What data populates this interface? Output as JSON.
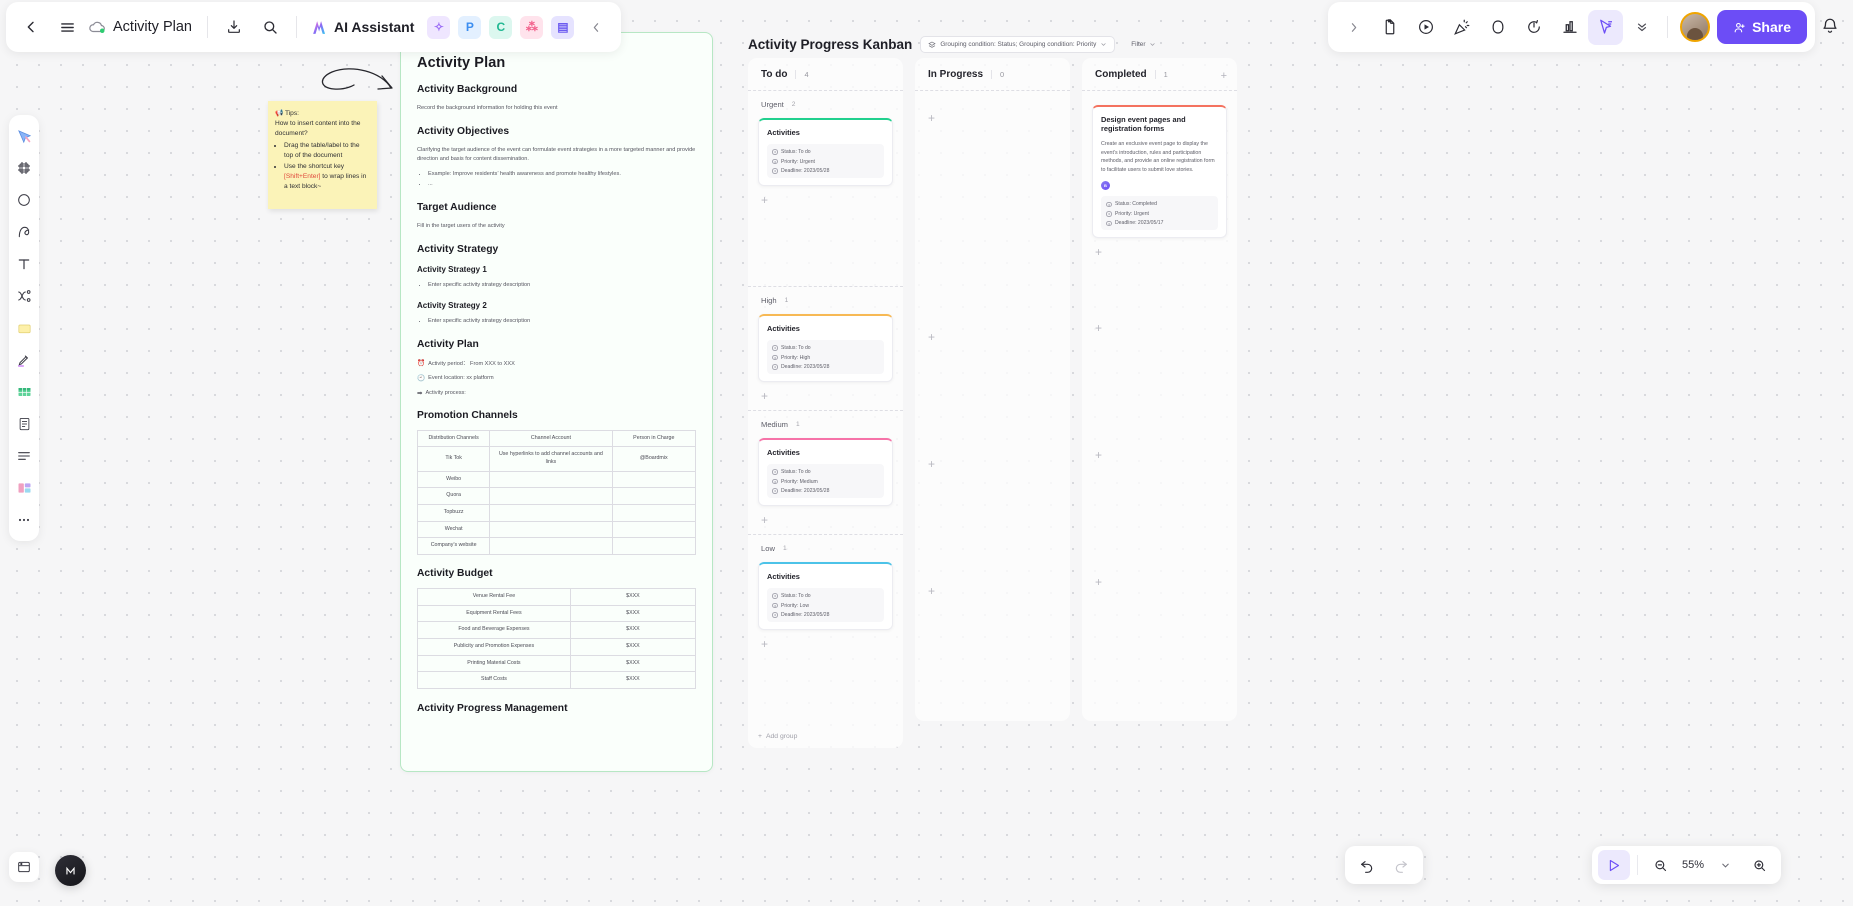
{
  "topbar": {
    "back_icon": "chevron-left-icon",
    "menu_icon": "hamburger-menu-icon",
    "doc_title": "Activity Plan",
    "download_icon": "download-icon",
    "search_icon": "search-icon",
    "ai_assistant_label": "AI Assistant",
    "apps": [
      {
        "name": "image-app",
        "glyph": "✧",
        "bg": "#efe6ff",
        "fg": "#9b6cf6"
      },
      {
        "name": "presentation-app",
        "glyph": "P",
        "bg": "#e3f0ff",
        "fg": "#3c8ef0"
      },
      {
        "name": "mindmap-app",
        "glyph": "C",
        "bg": "#dcf7ef",
        "fg": "#21b892"
      },
      {
        "name": "network-app",
        "glyph": "☸",
        "bg": "#ffe3ec",
        "fg": "#f25f8a"
      },
      {
        "name": "chat-app",
        "glyph": "▤",
        "bg": "#e6e3ff",
        "fg": "#6c5bf0"
      }
    ],
    "collapse_icon": "chevron-left-icon",
    "right_expand_icon": "chevron-right-icon",
    "right_tools": [
      {
        "name": "note-tool",
        "glyph": "note"
      },
      {
        "name": "record-tool",
        "glyph": "record"
      },
      {
        "name": "celebrate-tool",
        "glyph": "celebrate"
      },
      {
        "name": "shape-tool",
        "glyph": "shape"
      },
      {
        "name": "timer-tool",
        "glyph": "timer"
      },
      {
        "name": "chart-tool",
        "glyph": "chart"
      },
      {
        "name": "pointer-tool",
        "glyph": "pointer"
      }
    ],
    "more_icon": "chevron-double-down-icon",
    "share_label": "Share",
    "bell_icon": "bell-icon"
  },
  "rail": {
    "items": [
      {
        "name": "select-tool",
        "icon": "cursor-select-icon"
      },
      {
        "name": "frame-tool",
        "icon": "frame-icon"
      },
      {
        "name": "shape-tool",
        "icon": "circle-icon"
      },
      {
        "name": "pen-tool",
        "icon": "curve-icon"
      },
      {
        "name": "text-tool",
        "icon": "text-T-icon"
      },
      {
        "name": "connector-tool",
        "icon": "connector-icon"
      },
      {
        "name": "sticky-note-tool",
        "icon": "sticky-note-icon"
      },
      {
        "name": "highlighter-tool",
        "icon": "highlighter-icon"
      },
      {
        "name": "table-tool",
        "icon": "table-icon"
      },
      {
        "name": "document-tool",
        "icon": "document-icon"
      },
      {
        "name": "list-tool",
        "icon": "list-icon"
      },
      {
        "name": "template-tool",
        "icon": "template-icon"
      },
      {
        "name": "more-tools",
        "icon": "ellipsis-icon"
      }
    ],
    "bottom_icon": "export-frame-icon",
    "fab_icon": "assistant-avatar-icon"
  },
  "sticky_note": {
    "emoji": "📢",
    "title": "Tips:",
    "question": "How to insert content into the document?",
    "bullets": [
      "Drag the table/label to the top of the document",
      "Use the shortcut key [Shift+Enter] to wrap lines in a text block~"
    ],
    "highlight": "[Shift+Enter]"
  },
  "document": {
    "title": "Activity Plan",
    "sections": [
      {
        "heading": "Activity Background",
        "body": "Record the background information for holding this event"
      }
    ],
    "objectives_heading": "Activity Objectives",
    "objectives_body": "Clarifying the target audience of the event can formulate event strategies in a more targeted manner and provide direction and basis for content dissemination.",
    "objectives_bullets": [
      "Example: Improve residents’  health awareness and promote healthy lifestyles.",
      "..."
    ],
    "target_audience_heading": "Target Audience",
    "target_audience_body": "Fill in the target users of the activity",
    "strategy_heading": "Activity Strategy",
    "strategy_1_heading": "Activity Strategy 1",
    "strategy_1_bullet": "Enter specific activity strategy description",
    "strategy_2_heading": "Activity Strategy 2",
    "strategy_2_bullet": "Enter specific activity strategy description",
    "plan_heading": "Activity Plan",
    "plan_period": "Activity period： From XXX to XXX",
    "plan_location": "Event location: xx platform",
    "plan_process": "Activity process:",
    "promotion_heading": "Promotion Channels",
    "promotion_table": {
      "headers": [
        "Distribution Channels",
        "Channel Account",
        "Person in Charge"
      ],
      "rows": [
        [
          "Tik Tok",
          "Use hyperlinks to add channel accounts and links",
          "@Boardmix"
        ],
        [
          "Weibo",
          "",
          ""
        ],
        [
          "Quora",
          "",
          ""
        ],
        [
          "Topbuzz",
          "",
          ""
        ],
        [
          "Wechat",
          "",
          ""
        ],
        [
          "Company’s website",
          "",
          ""
        ]
      ]
    },
    "budget_heading": "Activity Budget",
    "budget_table": {
      "rows": [
        [
          "Venue Rental Fee",
          "$XXX"
        ],
        [
          "Equipment Rental Fees",
          "$XXX"
        ],
        [
          "Food and Beverage Expenses",
          "$XXX"
        ],
        [
          "Publicity and Promotion Expenses",
          "$XXX"
        ],
        [
          "Printing Material Costs",
          "$XXX"
        ],
        [
          "Staff Costs",
          "$XXX"
        ]
      ]
    },
    "progress_heading": "Activity Progress Management"
  },
  "kanban": {
    "title": "Activity Progress Kanban",
    "grouping_label": "Grouping condition: Status; Grouping condition: Priority",
    "grouping_icon": "layers-icon",
    "grouping_caret": "chevron-down-icon",
    "filter_label": "Filter",
    "filter_caret": "chevron-down-icon",
    "add_group_label": "Add group",
    "columns": [
      {
        "name": "To do",
        "count": "4",
        "groups": [
          {
            "name": "Urgent",
            "count": "2",
            "accent": "#21d08e",
            "cards": [
              {
                "title": "Activities",
                "desc": "",
                "props": [
                  {
                    "label": "Status: To do"
                  },
                  {
                    "label": "Priority: Urgent"
                  },
                  {
                    "label": "Deadline: 2023/05/28"
                  }
                ]
              }
            ]
          },
          {
            "name": "High",
            "count": "1",
            "accent": "#f7b955",
            "cards": [
              {
                "title": "Activities",
                "desc": "",
                "props": [
                  {
                    "label": "Status: To do"
                  },
                  {
                    "label": "Priority: High"
                  },
                  {
                    "label": "Deadline: 2023/05/28"
                  }
                ]
              }
            ]
          },
          {
            "name": "Medium",
            "count": "1",
            "accent": "#f673a8",
            "cards": [
              {
                "title": "Activities",
                "desc": "",
                "props": [
                  {
                    "label": "Status: To do"
                  },
                  {
                    "label": "Priority: Medium"
                  },
                  {
                    "label": "Deadline: 2023/05/28"
                  }
                ]
              }
            ]
          },
          {
            "name": "Low",
            "count": "1",
            "accent": "#4cc3e8",
            "cards": [
              {
                "title": "Activities",
                "desc": "",
                "props": [
                  {
                    "label": "Status: To do"
                  },
                  {
                    "label": "Priority: Low"
                  },
                  {
                    "label": "Deadline: 2023/05/28"
                  }
                ]
              }
            ]
          }
        ]
      },
      {
        "name": "In Progress",
        "count": "0",
        "groups": []
      },
      {
        "name": "Completed",
        "count": "1",
        "groups": [
          {
            "name": "",
            "count": "",
            "accent": "#f4725f",
            "cards": [
              {
                "title": "Design event pages and registration forms",
                "desc": "Create an exclusive event page to display the event’s introduction, rules and participation methods, and provide an online registration form to facilitate users to submit love stories.",
                "avatar": "B",
                "props": [
                  {
                    "label": "Status: Completed"
                  },
                  {
                    "label": "Priority: Urgent"
                  },
                  {
                    "label": "Deadline: 2023/05/17"
                  }
                ]
              }
            ]
          }
        ]
      }
    ]
  },
  "bottombar": {
    "undo_icon": "undo-arrow-icon",
    "redo_icon": "redo-arrow-icon",
    "present_icon": "play-icon",
    "zoom_out_icon": "zoom-out-icon",
    "zoom_value": "55%",
    "zoom_caret": "chevron-down-icon",
    "zoom_in_icon": "zoom-in-icon"
  }
}
